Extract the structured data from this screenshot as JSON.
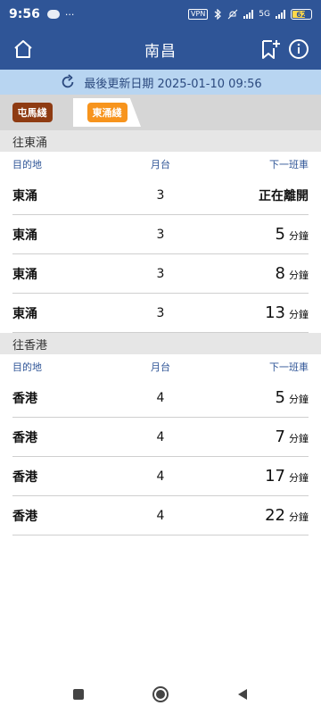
{
  "status_bar": {
    "time": "9:56",
    "more": "···",
    "vpn": "VPN",
    "net_tag1": "5G",
    "battery": "62"
  },
  "app_bar": {
    "title": "南昌",
    "home_icon": "home-icon",
    "bookmark_icon": "bookmark-add-icon",
    "info_icon": "info-icon"
  },
  "update_bar": {
    "text": "最後更新日期 2025-01-10 09:56",
    "icon": "refresh-icon"
  },
  "line_tabs": [
    {
      "label": "屯馬綫",
      "color": "#8e3b12",
      "active": false
    },
    {
      "label": "東涌綫",
      "color": "#f7941d",
      "active": true
    }
  ],
  "column_headers": {
    "destination": "目的地",
    "platform": "月台",
    "next_train": "下一班車"
  },
  "sections": [
    {
      "title": "往東涌",
      "rows": [
        {
          "destination": "東涌",
          "platform": "3",
          "eta": "",
          "unit": "",
          "status": "正在離開"
        },
        {
          "destination": "東涌",
          "platform": "3",
          "eta": "5",
          "unit": "分鐘",
          "status": ""
        },
        {
          "destination": "東涌",
          "platform": "3",
          "eta": "8",
          "unit": "分鐘",
          "status": ""
        },
        {
          "destination": "東涌",
          "platform": "3",
          "eta": "13",
          "unit": "分鐘",
          "status": ""
        }
      ]
    },
    {
      "title": "往香港",
      "rows": [
        {
          "destination": "香港",
          "platform": "4",
          "eta": "5",
          "unit": "分鐘",
          "status": ""
        },
        {
          "destination": "香港",
          "platform": "4",
          "eta": "7",
          "unit": "分鐘",
          "status": ""
        },
        {
          "destination": "香港",
          "platform": "4",
          "eta": "17",
          "unit": "分鐘",
          "status": ""
        },
        {
          "destination": "香港",
          "platform": "4",
          "eta": "22",
          "unit": "分鐘",
          "status": ""
        }
      ]
    }
  ],
  "nav_bar": {
    "recents_icon": "square-icon",
    "home_icon": "circle-home-icon",
    "back_icon": "back-triangle-icon"
  },
  "colors": {
    "primary": "#2f5597",
    "update_bg": "#b8d5f1"
  }
}
